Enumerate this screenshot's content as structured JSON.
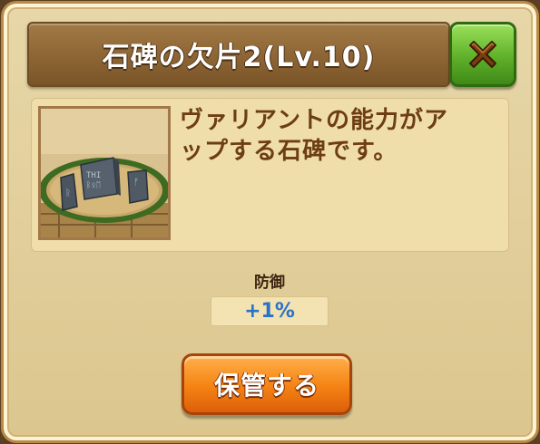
{
  "dialog": {
    "title": "石碑の欠片2(Lv.10)",
    "description_line1": "ヴァリアントの能力がア",
    "description_line2": "ップする石碑です。"
  },
  "stat": {
    "label": "防御",
    "value": "+1%"
  },
  "buttons": {
    "store_label": "保管する",
    "close_icon": "close-x-icon"
  },
  "item": {
    "icon": "stone-monument-icon"
  },
  "colors": {
    "accent_green": "#5fb02a",
    "accent_orange": "#f58214",
    "title_brown": "#8b6333",
    "description_text": "#6d3d14",
    "stat_value": "#2a72c6"
  }
}
